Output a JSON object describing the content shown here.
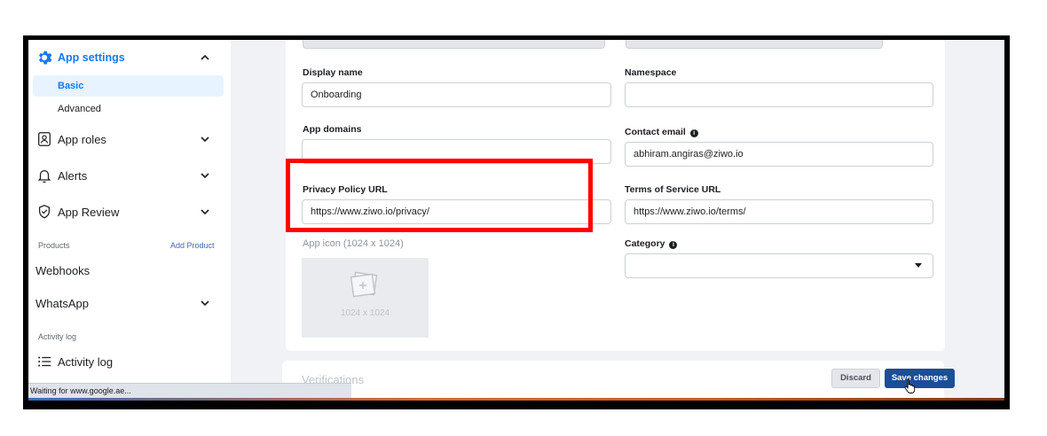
{
  "sidebar": {
    "app_settings": "App settings",
    "sub_items": [
      {
        "label": "Basic",
        "active": true
      },
      {
        "label": "Advanced",
        "active": false
      }
    ],
    "nav_items": [
      {
        "label": "App roles",
        "icon": "id-card-icon"
      },
      {
        "label": "Alerts",
        "icon": "bell-icon"
      },
      {
        "label": "App Review",
        "icon": "shield-check-icon"
      }
    ],
    "products_label": "Products",
    "add_product": "Add Product",
    "webhooks": "Webhooks",
    "whatsapp": "WhatsApp",
    "activity_section": "Activity log",
    "activity_log": "Activity log"
  },
  "status_bar": "Waiting for www.google.ae...",
  "form": {
    "display_name_label": "Display name",
    "display_name_value": "Onboarding",
    "namespace_label": "Namespace",
    "namespace_value": "",
    "app_domains_label": "App domains",
    "app_domains_value": "",
    "contact_email_label": "Contact email",
    "contact_email_value": "abhiram.angiras@ziwo.io",
    "privacy_label": "Privacy Policy URL",
    "privacy_value": "https://www.ziwo.io/privacy/",
    "terms_label": "Terms of Service URL",
    "terms_value": "https://www.ziwo.io/terms/",
    "app_icon_label": "App icon (1024 x 1024)",
    "app_icon_size": "1024 x 1024",
    "category_label": "Category",
    "category_value": ""
  },
  "footer": {
    "verifications": "Verifications",
    "discard": "Discard",
    "save": "Save changes"
  },
  "colors": {
    "accent": "#1877f2",
    "save_button": "#1b4e97",
    "highlight": "#ff0000"
  }
}
